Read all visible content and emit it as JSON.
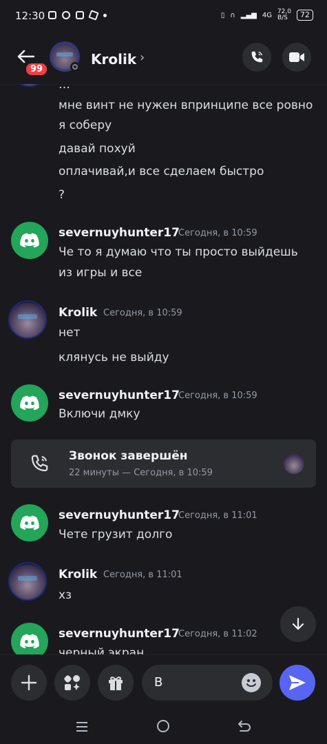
{
  "status": {
    "time": "12:30",
    "net": "4G",
    "speed": "72,0",
    "speed_unit": "B/S",
    "battery": "72"
  },
  "header": {
    "name": "Krolik",
    "unread_badge": "99",
    "chevron": "›"
  },
  "messages": {
    "k0": "мне винт не нужен впринципе все ровно",
    "k1": "я соберу",
    "k2": "давай похуй",
    "k3": "оплачивай,и все сделаем быстро",
    "k4": "?",
    "g1": {
      "name": "severnuyhunter17",
      "time": "Сегодня, в 10:59",
      "l1": "Че то я думаю что ты просто выйдешь",
      "l2": "из игры и все"
    },
    "g2": {
      "name": "Krolik",
      "time": "Сегодня, в 10:59",
      "l1": "нет",
      "l2": "клянусь не выйду"
    },
    "g3": {
      "name": "severnuyhunter17",
      "time": "Сегодня, в 10:59",
      "l1": "Включи дмку"
    },
    "call": {
      "title": "Звонок завершён",
      "sub": "22 минуты — Сегодня, в 10:59"
    },
    "g4": {
      "name": "severnuyhunter17",
      "time": "Сегодня, в 11:01",
      "l1": "Чете грузит долго"
    },
    "g5": {
      "name": "Krolik",
      "time": "Сегодня, в 11:01",
      "l1": "хз"
    },
    "g6": {
      "name": "severnuyhunter17",
      "time": "Сегодня, в 11:02",
      "l1": "черный экран"
    }
  },
  "composer": {
    "input_value": "В"
  },
  "colors": {
    "accent": "#5865f2",
    "discord_green": "#23a55a",
    "badge_red": "#f23f43"
  }
}
